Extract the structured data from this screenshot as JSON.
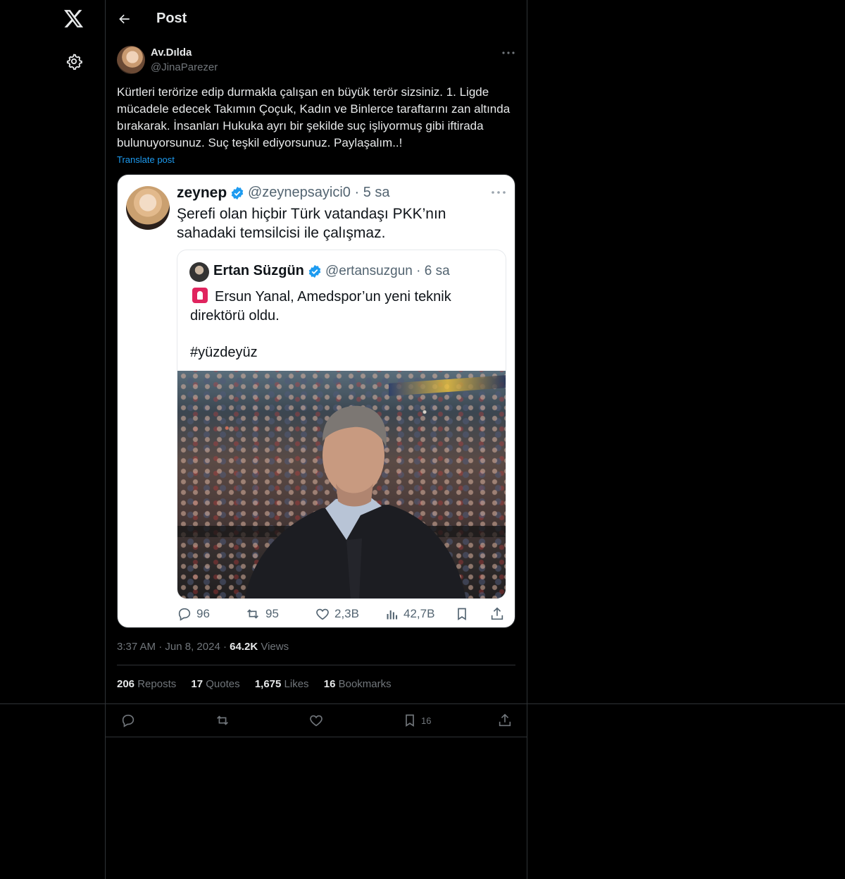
{
  "nav": {
    "logo_icon": "x-logo-icon",
    "settings_icon": "gear-icon"
  },
  "header": {
    "title": "Post",
    "back_icon": "arrow-left-icon"
  },
  "post": {
    "display_name": "Av.Dılda",
    "handle": "@JinaParezer",
    "text": "Kürtleri terörize edip durmakla çalışan en büyük terör sizsiniz. 1. Ligde mücadele edecek Takımın Çoçuk, Kadın ve Binlerce taraftarını zan altında bırakarak. İnsanları Hukuka ayrı bir şekilde suç işliyormuş gibi iftirada bulunuyorsunuz. Suç teşkil ediyorsunuz. Paylaşalım..!",
    "translate_label": "Translate post",
    "time": "3:37 AM",
    "date": "Jun 8, 2024",
    "views_count": "64.2K",
    "views_label": "Views"
  },
  "embedded": {
    "name": "zeynep",
    "handle_time": "@zeynepsayici0 · 5 sa",
    "text": "Şerefi olan hiçbir Türk vatandaşı PKK’nın sahadaki temsilcisi ile çalışmaz.",
    "quote": {
      "name": "Ertan Süzgün",
      "handle_time": "@ertansuzgun · 6 sa",
      "text": "Ersun Yanal, Amedspor’un yeni teknik direktörü oldu.",
      "hashtag": "#yüzdeyüz"
    },
    "actions": {
      "replies": "96",
      "reposts": "95",
      "likes": "2,3B",
      "views": "42,7B"
    }
  },
  "stats": {
    "reposts_count": "206",
    "reposts_label": "Reposts",
    "quotes_count": "17",
    "quotes_label": "Quotes",
    "likes_count": "1,675",
    "likes_label": "Likes",
    "bookmarks_count": "16",
    "bookmarks_label": "Bookmarks"
  },
  "actionbar": {
    "bookmark_count": "16"
  },
  "colors": {
    "background": "#000000",
    "accent": "#1d9bf0",
    "muted": "#71767b",
    "border": "#2f3336"
  }
}
